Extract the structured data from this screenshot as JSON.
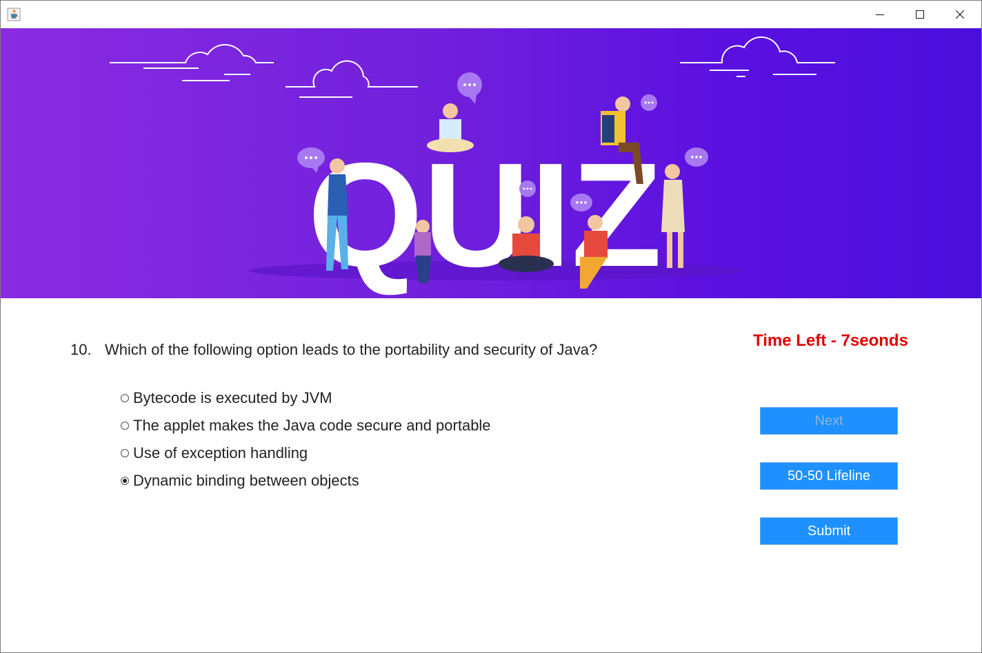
{
  "window": {
    "icon": "java-cup-icon",
    "controls": [
      "minimize-icon",
      "maximize-icon",
      "close-icon"
    ]
  },
  "banner": {
    "word": "QUIZ",
    "colors": {
      "start": "#8a2be2",
      "end": "#4a0fdc"
    }
  },
  "question": {
    "number": "10.",
    "text": "Which of the following option leads to the portability and security of Java?"
  },
  "timer": {
    "text": "Time Left - 7seonds",
    "color": "#e00000"
  },
  "options": [
    {
      "label": "Bytecode is executed by JVM",
      "selected": false
    },
    {
      "label": "The applet makes the Java code secure and portable",
      "selected": false
    },
    {
      "label": "Use of exception handling",
      "selected": false
    },
    {
      "label": "Dynamic binding between objects",
      "selected": true
    }
  ],
  "buttons": {
    "next": {
      "label": "Next",
      "enabled": false
    },
    "lifeline": {
      "label": "50-50 Lifeline",
      "enabled": true
    },
    "submit": {
      "label": "Submit",
      "enabled": true
    },
    "color": "#1e90ff"
  }
}
